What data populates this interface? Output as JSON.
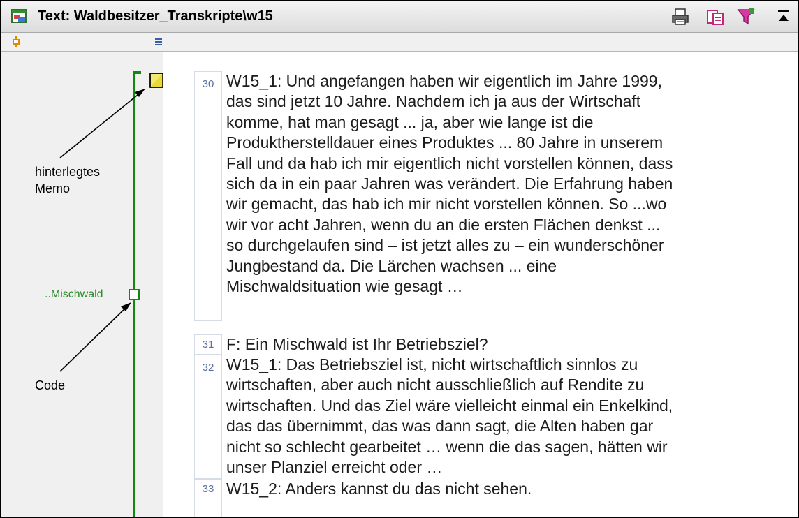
{
  "window": {
    "title": "Text: Waldbesitzer_Transkripte\\w15",
    "toolbar_icons": [
      "print-icon",
      "export-icon",
      "filter-icon",
      "collapse-icon"
    ]
  },
  "column_header": {
    "left_icon": "code-column-icon",
    "right_icon": "list-column-icon"
  },
  "margin": {
    "code_label": "..Mischwald",
    "code_color": "#118811",
    "memo_color": "#f2ea6e"
  },
  "annotations": {
    "memo": "hinterlegtes\nMemo",
    "code": "Code"
  },
  "paragraphs": [
    {
      "num": "30",
      "text": "W15_1: Und angefangen haben wir eigentlich im Jahre 1999,\ndas sind jetzt 10 Jahre. Nachdem ich ja aus der Wirtschaft\nkomme, hat man gesagt ... ja, aber wie lange ist die\nProduktherstelldauer eines Produktes ... 80 Jahre in unserem\nFall und da hab ich mir eigentlich nicht vorstellen können, dass\nsich da in ein paar Jahren was verändert. Die Erfahrung haben\nwir gemacht, das hab ich mir nicht vorstellen können. So ...wo\nwir vor acht Jahren, wenn du an die ersten Flächen denkst ...\nso durchgelaufen sind – ist jetzt alles zu – ein wunderschöner\nJungbestand da. Die Lärchen wachsen ... eine\nMischwaldsituation wie gesagt …"
    },
    {
      "num": "31",
      "text": "F: Ein Mischwald ist Ihr Betriebsziel?"
    },
    {
      "num": "32",
      "text": "W15_1: Das Betriebsziel ist, nicht wirtschaftlich sinnlos zu\nwirtschaften, aber auch nicht ausschließlich auf Rendite zu\nwirtschaften. Und das Ziel wäre vielleicht einmal ein Enkelkind,\ndas das übernimmt, das was dann sagt, die Alten haben gar\nnicht so schlecht gearbeitet … wenn die das sagen, hätten wir\nunser Planziel erreicht oder …"
    },
    {
      "num": "33",
      "text": "W15_2: Anders kannst du das nicht sehen."
    }
  ]
}
